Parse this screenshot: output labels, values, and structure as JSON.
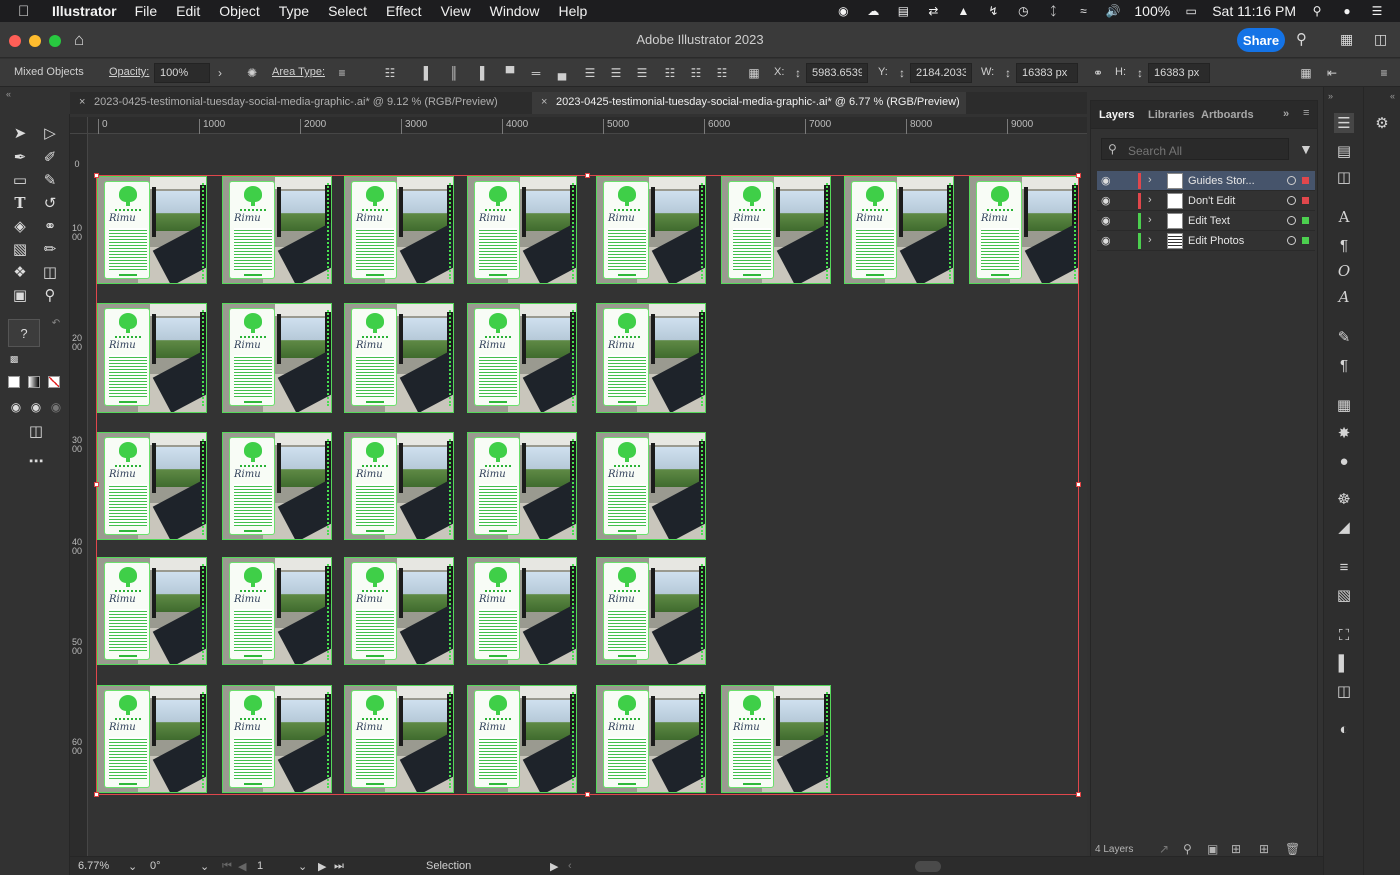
{
  "menubar": {
    "app_name": "Illustrator",
    "menus": [
      "File",
      "Edit",
      "Object",
      "Type",
      "Select",
      "Effect",
      "View",
      "Window",
      "Help"
    ],
    "battery": "100%",
    "clock": "Sat 11:16 PM"
  },
  "window": {
    "title": "Adobe Illustrator 2023",
    "share_label": "Share"
  },
  "control": {
    "selection_label": "Mixed Objects",
    "opacity_label": "Opacity:",
    "opacity_value": "100%",
    "area_type_label": "Area Type:",
    "x_label": "X:",
    "x_value": "5983.6539 p",
    "y_label": "Y:",
    "y_value": "2184.2033 p",
    "w_label": "W:",
    "w_value": "16383 px",
    "h_label": "H:",
    "h_value": "16383 px"
  },
  "tabs": [
    {
      "label": "2023-0425-testimonial-tuesday-social-media-graphic-.ai* @ 9.12 % (RGB/Preview)",
      "active": false
    },
    {
      "label": "2023-0425-testimonial-tuesday-social-media-graphic-.ai* @ 6.77 % (RGB/Preview)",
      "active": true
    }
  ],
  "ruler": {
    "h_ticks": [
      "0",
      "1000",
      "2000",
      "3000",
      "4000",
      "5000",
      "6000",
      "7000",
      "8000",
      "9000"
    ],
    "v_ticks": [
      "0",
      "1000",
      "2000",
      "3000",
      "4000",
      "5000",
      "6000"
    ]
  },
  "artboards": {
    "rows": [
      8,
      5,
      5,
      5,
      6
    ],
    "signature_text": "Rimu"
  },
  "layers_panel": {
    "tabs": [
      "Layers",
      "Libraries",
      "Artboards"
    ],
    "search_placeholder": "Search All",
    "layers": [
      {
        "name": "Guides Stor...",
        "color": "#e0474c",
        "selected": true
      },
      {
        "name": "Don't Edit",
        "color": "#e0474c",
        "selected": false
      },
      {
        "name": "Edit Text",
        "color": "#4ccf4f",
        "selected": false
      },
      {
        "name": "Edit Photos",
        "color": "#4ccf4f",
        "selected": false
      }
    ],
    "layer_count": "4 Layers"
  },
  "statusbar": {
    "zoom": "6.77%",
    "rotation": "0°",
    "artboard_number": "1",
    "tool": "Selection"
  },
  "colors": {
    "accent": "#1473e6",
    "selection": "#e0474c",
    "artboard_outline": "#55d85a"
  }
}
